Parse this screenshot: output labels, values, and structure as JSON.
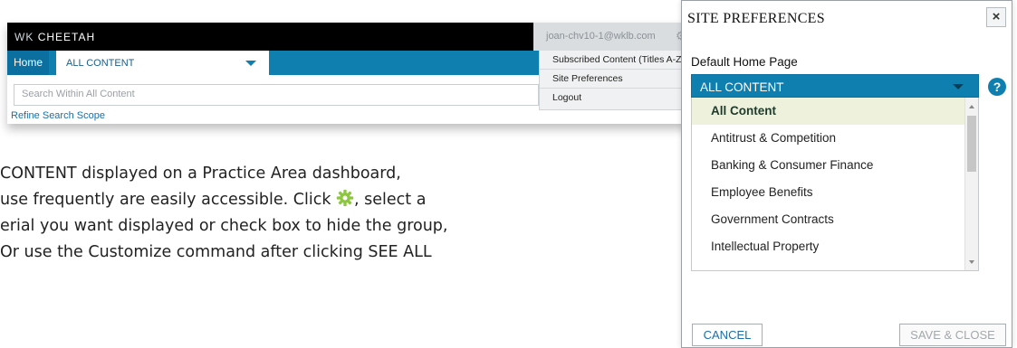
{
  "app": {
    "brand_prefix": "WK",
    "brand_name": "CHEETAH",
    "user_email": "joan-chv10-1@wklb.com",
    "nav_home": "Home",
    "nav_selected": "ALL CONTENT",
    "search_placeholder": "Search Within All Content",
    "refine_link": "Refine Search Scope",
    "user_menu": [
      "Subscribed Content (Titles A-Z)",
      "Site Preferences",
      "Logout"
    ]
  },
  "paragraph": {
    "line1": " CONTENT displayed on a Practice Area dashboard,",
    "line2a": "use frequently are easily accessible. Click ",
    "line2b": ", select a",
    "line3": "erial you want displayed or check box to hide the group,",
    "line4": " Or use the Customize command after clicking SEE ALL"
  },
  "dialog": {
    "title": "SITE PREFERENCES",
    "close_glyph": "×",
    "label": "Default Home Page",
    "selected_value": "ALL CONTENT",
    "help_glyph": "?",
    "options": [
      "All Content",
      "Antitrust & Competition",
      "Banking & Consumer Finance",
      "Employee Benefits",
      "Government Contracts",
      "Intellectual Property"
    ],
    "cancel_label": "CANCEL",
    "save_label": "SAVE & CLOSE"
  },
  "colors": {
    "accent_blue": "#0f7fb0",
    "gear_green": "#8dc63f",
    "selected_row": "#eef2dc"
  },
  "icons": {
    "settings": "gear-icon",
    "dropdown": "chevron-down-icon",
    "help": "help-icon",
    "close": "close-icon"
  }
}
